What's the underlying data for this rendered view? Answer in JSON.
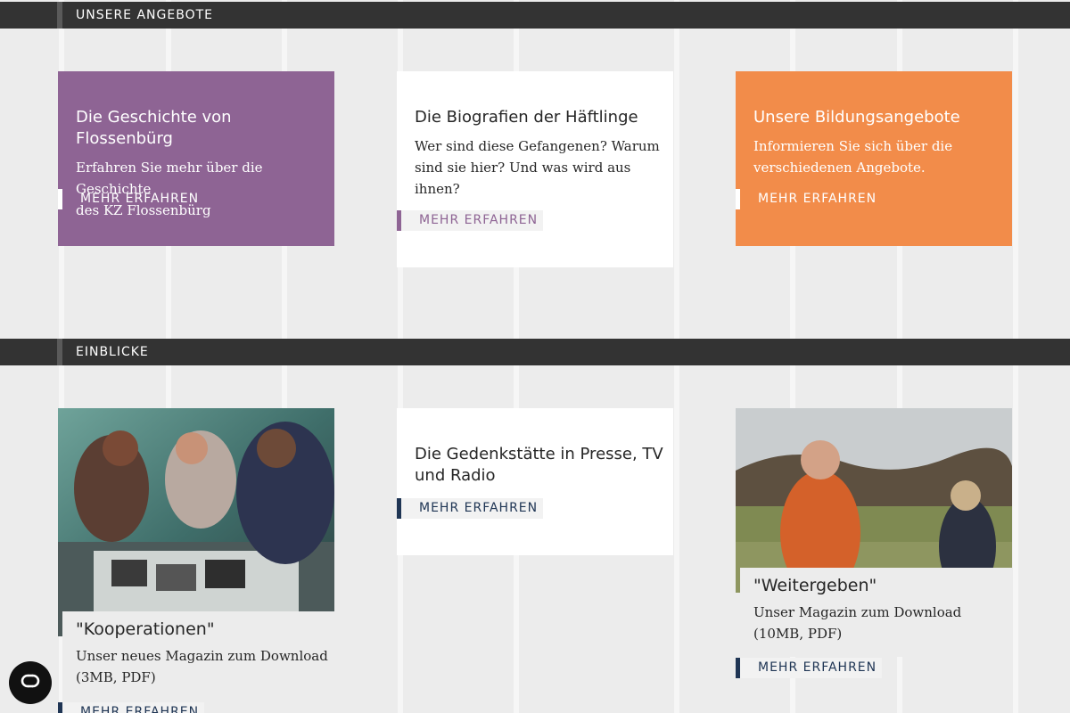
{
  "sections": {
    "angebote_title": "UNSERE ANGEBOTE",
    "einblicke_title": "EINBLICKE"
  },
  "angebote": [
    {
      "title": "Die Geschichte von Flossenbürg",
      "text_line1": "Erfahren Sie mehr über die Geschichte",
      "text_line2": "des KZ Flossenbürg",
      "link": "MEHR ERFAHREN"
    },
    {
      "title": "Die Biografien der Häftlinge",
      "text_line1": "Wer sind diese Gefangenen? Warum",
      "text_line2": "sind sie hier? Und was wird aus",
      "text_line3": "ihnen?",
      "link": "MEHR ERFAHREN"
    },
    {
      "title": "Unsere Bildungsangebote",
      "text_line1": "Informieren Sie sich über die",
      "text_line2": "verschiedenen Angebote.",
      "link": "MEHR ERFAHREN"
    }
  ],
  "einblicke": [
    {
      "title": "\"Kooperationen\"",
      "text_line1": "Unser neues Magazin zum Download",
      "text_line2": "(3MB, PDF)",
      "link": "MEHR ERFAHREN"
    },
    {
      "title_line1": "Die Gedenkstätte in Presse, TV",
      "title_line2": "und Radio",
      "link": "MEHR ERFAHREN"
    },
    {
      "title": "\"Weitergeben\"",
      "text_line1": "Unser Magazin zum Download",
      "text_line2": "(10MB, PDF)",
      "link": "MEHR ERFAHREN"
    }
  ],
  "colors": {
    "purple": "#8e6494",
    "orange": "#f28c4a",
    "navy": "#1f3554",
    "bar": "#333333"
  },
  "icons": {
    "cookie_settings": "cookie-settings-icon"
  }
}
